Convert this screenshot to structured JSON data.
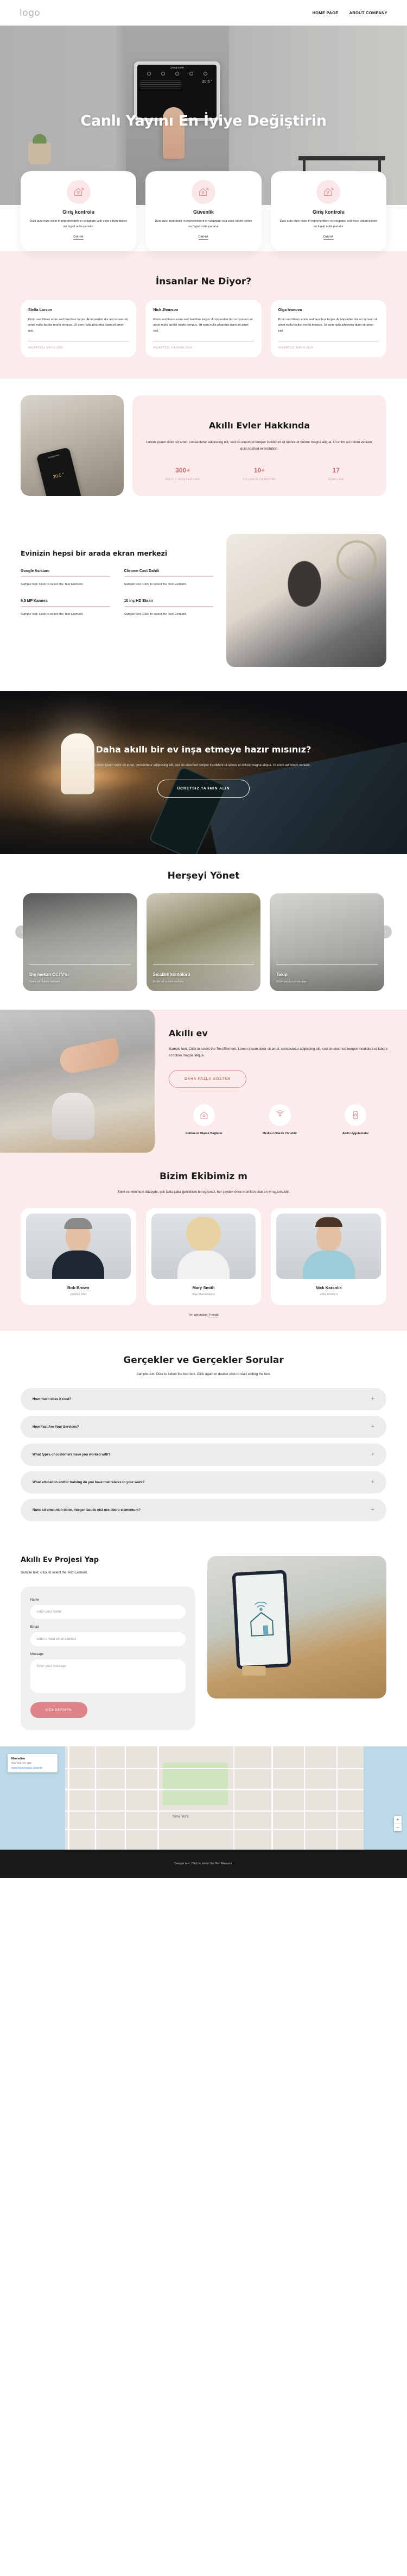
{
  "header": {
    "logo": "logo",
    "nav": [
      {
        "label": "HOME PAGE"
      },
      {
        "label": "ABOUT COMPANY"
      }
    ]
  },
  "hero": {
    "title": "Canlı Yayını En İyiye Değiştirin",
    "device_room_label": "Living room",
    "device_temp": "20,5 °"
  },
  "features": [
    {
      "icon": "smart-home-signal-icon",
      "title": "Giriş kontrolu",
      "text": "Duis aute irure dolor in reprehenderit in voluptate velit esse cillum dolore eu fugiat nulla pariatur",
      "more": "DAHA"
    },
    {
      "icon": "smart-home-signal-icon",
      "title": "Güvenlik",
      "text": "Duis aute irure dolor in reprehenderit in voluptate velit esse cillum dolore eu fugiat nulla pariatur",
      "more": "DAHA"
    },
    {
      "icon": "smart-home-signal-icon",
      "title": "Giriş kontrolu",
      "text": "Duis aute irure dolor in reprehenderit in voluptate velit esse cillum dolore eu fugiat nulla pariatur",
      "more": "DAHA"
    }
  ],
  "testimonials": {
    "heading": "İnsanlar Ne Diyor?",
    "items": [
      {
        "name": "Stella Larson",
        "text": "Proin sed libero enim sed faucibus turpis. At imperdiet dui accumsan sit amet nulla facilisi morbi tempus. Ut sem nulla pharetra diam sit amet nisl.",
        "date": "PAZARTESI, MAYIS 2024"
      },
      {
        "name": "Nick Jhonson",
        "text": "Proin sed libero enim sed faucibus turpis. At imperdiet dui accumsan sit amet nulla facilisi morbi tempus. Ut sem nulla pharetra diam sit amet nisl.",
        "date": "PAZARTESI, HAZIRAN 2024"
      },
      {
        "name": "Olga Ivanova",
        "text": "Proin sed libero enim sed faucibus turpis. At imperdiet dui accumsan sit amet nulla facilisi morbi tempus. Ut sem nulla pharetra diam sit amet nisl.",
        "date": "PAZARTESI, MAYIS 2024"
      }
    ]
  },
  "about": {
    "heading": "Akıllı Evler Hakkında",
    "text": "Lorem ipsum dolor sit amet, consectetur adipiscing elit, sed do eiusmod tempor incididunt ut labore et dolore magna aliqua. Ut enim ad minim veniam, quis nostrud exercitation.",
    "stats": [
      {
        "number": "300+",
        "label": "MUTLU MÜŞTERILER"
      },
      {
        "number": "10+",
        "label": "YILLARIN DENEYIMI"
      },
      {
        "number": "17",
        "label": "ÖDÜLLER"
      }
    ],
    "phone_room_label": "Living room",
    "phone_temp": "20,5 °"
  },
  "screen_center": {
    "heading": "Evinizin hepsi bir arada ekran merkezi",
    "items": [
      {
        "title": "Google Asistanı",
        "text": "Sample text. Click to select the Text Element."
      },
      {
        "title": "Chrome Cast Dahili",
        "text": "Sample text. Click to select the Text Element."
      },
      {
        "title": "6,5 MP Kamera",
        "text": "Sample text. Click to select the Text Element."
      },
      {
        "title": "10 inç HD Ekran",
        "text": "Sample text. Click to select the Text Element."
      }
    ]
  },
  "cta": {
    "heading": "Daha akıllı bir ev inşa etmeye hazır mısınız?",
    "text": "Lorem ipsum dolor sit amet, consectetur adipiscing elit, sed do eiusmod tempor incididunt ut labore et dolore magna aliqua. Ut enim ad minim veniam. .",
    "button": "ÜCRETSIZ TAHMIN ALIN"
  },
  "manage": {
    "heading": "Herşeyi Yönet",
    "prev_icon": "chevron-left-icon",
    "next_icon": "chevron-right-icon",
    "cards": [
      {
        "title": "Dış mekan CCTV'si",
        "text": "Enim ad minim veniam"
      },
      {
        "title": "Sıcaklık kontolörü",
        "text": "Enim ad minim veniam"
      },
      {
        "title": "Takip",
        "text": "Enim ad minim veniam"
      }
    ]
  },
  "smart": {
    "heading": "Akıllı ev",
    "text": "Sample text. Click to select the Text Element. Lorem ipsum dolor sit amet, consectetur adipiscing elit, sed do eiusmod tempor incididunt ut labore et dolore magna aliqua.",
    "button": "DAHA FAZLA GÖSTER",
    "features": [
      {
        "icon": "home-outline-icon",
        "label": "Kablosuz Olarak Bağlanır"
      },
      {
        "icon": "signal-waves-icon",
        "label": "Merkezi Olarak Yönetilir"
      },
      {
        "icon": "smartphone-icon",
        "label": "Akıllı Uygulamalar"
      }
    ]
  },
  "team": {
    "heading": "Bizim Ekibimiz m",
    "subtitle": "Enim ve minimum düzeyde, çok fazla çaba gerektiren bir egzersiz, her şeyden önce mümkün olan en iyi egzersizdir.",
    "members": [
      {
        "name": "Bob Brown",
        "role": "yaratıcı lider"
      },
      {
        "name": "Mary Smith",
        "role": "Baş Muhasebeci"
      },
      {
        "name": "Nick Karanlık",
        "role": "satış Müdürü"
      }
    ],
    "credit_prefix": "Ten görüntüler ",
    "credit_link": "Freepik"
  },
  "faq": {
    "heading": "Gerçekler ve Gerçekler Sorular",
    "subtitle": "Sample text. Click to select the text box. Click again or double click to start editing the text.",
    "items": [
      {
        "question": "How much does it cost?",
        "toggle": "+"
      },
      {
        "question": "How Fast Are Your Services?",
        "toggle": "+"
      },
      {
        "question": "What types of customers have you worked with?",
        "toggle": "+"
      },
      {
        "question": "What education and/or training do you have that relates to your work?",
        "toggle": "+"
      },
      {
        "question": "Nunc sit amet nibh dolor. Integer iaculis nisi nec libero elementum?",
        "toggle": "+"
      }
    ]
  },
  "contact": {
    "heading": "Akıllı Ev Projesi Yap",
    "subtitle": "Sample text. Click to select the Text Element.",
    "fields": [
      {
        "label": "Name",
        "placeholder": "Enter your Name",
        "value": ""
      },
      {
        "label": "Email",
        "placeholder": "Enter a valid email address",
        "value": ""
      },
      {
        "label": "Message",
        "placeholder": "Enter your message",
        "value": ""
      }
    ],
    "submit": "GÖNDERMEK"
  },
  "map": {
    "card_title": "Manhattan",
    "card_detail": "New York, NY, ABD",
    "card_action": "Daha büyük haritayı görüntüle",
    "area_label": "New York",
    "zoom_in": "+",
    "zoom_out": "−"
  },
  "footer": {
    "text_prefix": "Sample text. Click to select the Text Element.",
    "link": ""
  },
  "colors": {
    "accent": "#c76a6d",
    "pink_band": "#fbeceb",
    "submit": "#e08389",
    "dark": "#1a1a1a"
  }
}
